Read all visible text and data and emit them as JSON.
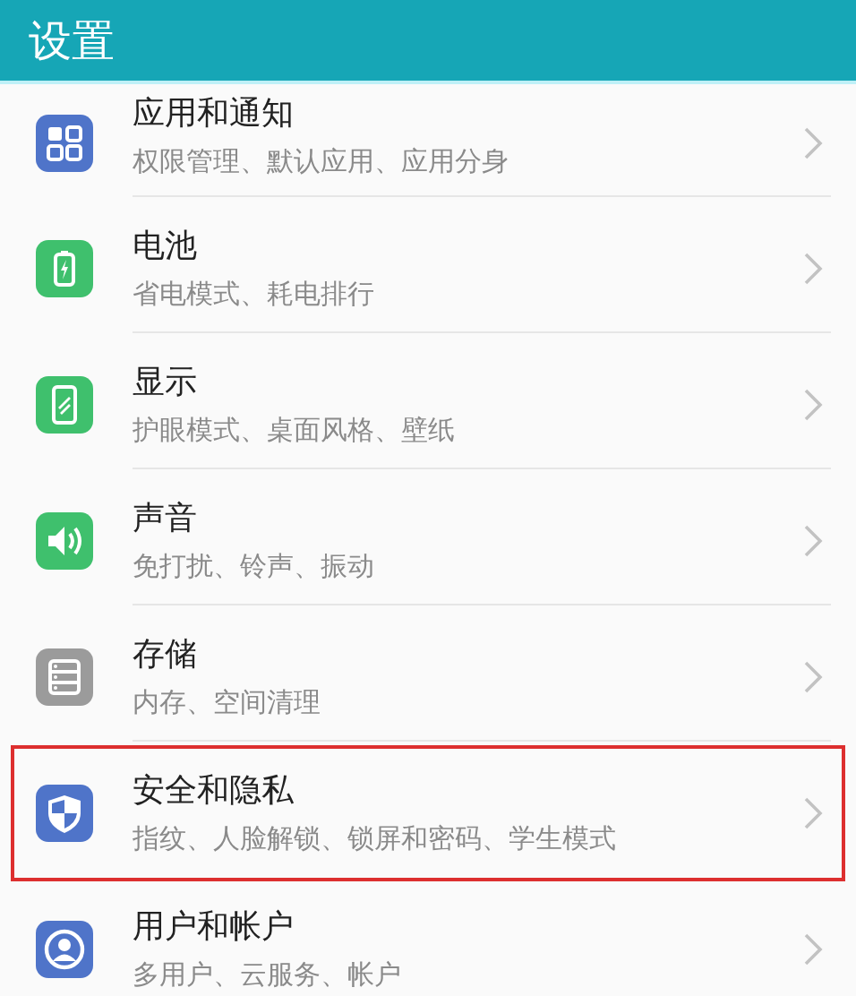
{
  "header": {
    "title": "设置"
  },
  "items": [
    {
      "title": "应用和通知",
      "subtitle": "权限管理、默认应用、应用分身",
      "kind": "grid",
      "color": "#4f74c9",
      "highlighted": false
    },
    {
      "title": "电池",
      "subtitle": "省电模式、耗电排行",
      "kind": "battery",
      "color": "#3fc06d",
      "highlighted": false
    },
    {
      "title": "显示",
      "subtitle": "护眼模式、桌面风格、壁纸",
      "kind": "display",
      "color": "#3fc06d",
      "highlighted": false
    },
    {
      "title": "声音",
      "subtitle": "免打扰、铃声、振动",
      "kind": "sound",
      "color": "#3fc06d",
      "highlighted": false
    },
    {
      "title": "存储",
      "subtitle": "内存、空间清理",
      "kind": "storage",
      "color": "#9b9b9b",
      "highlighted": false
    },
    {
      "title": "安全和隐私",
      "subtitle": "指纹、人脸解锁、锁屏和密码、学生模式",
      "kind": "shield",
      "color": "#4f74c9",
      "highlighted": true
    },
    {
      "title": "用户和帐户",
      "subtitle": "多用户、云服务、帐户",
      "kind": "user",
      "color": "#4f74c9",
      "highlighted": false
    }
  ]
}
